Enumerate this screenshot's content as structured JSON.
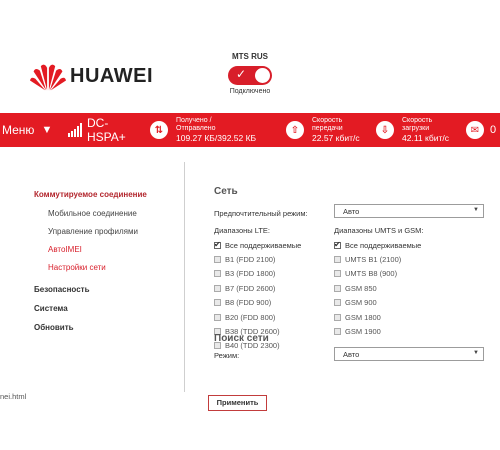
{
  "brand": "HUAWEI",
  "operator": {
    "name": "MTS RUS",
    "status": "Подключено",
    "toggle_on": true
  },
  "statusbar": {
    "menu_label": "Меню",
    "network_type": "DC-HSPA+",
    "signal_bars": 5,
    "transfer": {
      "label_line1": "Получено /",
      "label_line2": "Отправлено",
      "value": "109.27 КБ/392.52 КБ"
    },
    "upload": {
      "label_line1": "Скорость",
      "label_line2": "передачи",
      "value": "22.57 кбит/с"
    },
    "download": {
      "label_line1": "Скорость",
      "label_line2": "загрузки",
      "value": "42.11 кбит/с"
    },
    "messages": "0"
  },
  "nav": {
    "dialup": "Коммутируемое соединение",
    "items": [
      "Мобильное соединение",
      "Управление профилями",
      "AвтоIMEI",
      "Настройки сети"
    ],
    "security": "Безопасность",
    "system": "Система",
    "update": "Обновить"
  },
  "network": {
    "title": "Сеть",
    "preferred_mode_label": "Предпочтительный режим:",
    "preferred_mode_value": "Авто",
    "lte_header": "Диапазоны LTE:",
    "lte_bands": [
      {
        "label": "Все поддерживаемые",
        "checked": true
      },
      {
        "label": "B1 (FDD 2100)",
        "checked": false
      },
      {
        "label": "B3 (FDD 1800)",
        "checked": false
      },
      {
        "label": "B7 (FDD 2600)",
        "checked": false
      },
      {
        "label": "B8 (FDD 900)",
        "checked": false
      },
      {
        "label": "B20 (FDD 800)",
        "checked": false
      },
      {
        "label": "B38 (TDD 2600)",
        "checked": false
      },
      {
        "label": "B40 (TDD 2300)",
        "checked": false
      }
    ],
    "umts_header": "Диапазоны UMTS и GSM:",
    "umts_bands": [
      {
        "label": "Все поддерживаемые",
        "checked": true
      },
      {
        "label": "UMTS B1 (2100)",
        "checked": false
      },
      {
        "label": "UMTS B8 (900)",
        "checked": false
      },
      {
        "label": "GSM 850",
        "checked": false
      },
      {
        "label": "GSM 900",
        "checked": false
      },
      {
        "label": "GSM 1800",
        "checked": false
      },
      {
        "label": "GSM 1900",
        "checked": false
      }
    ]
  },
  "search": {
    "title": "Поиск сети",
    "mode_label": "Режим:",
    "mode_value": "Авто"
  },
  "apply_label": "Применить",
  "filename": "nei.html"
}
